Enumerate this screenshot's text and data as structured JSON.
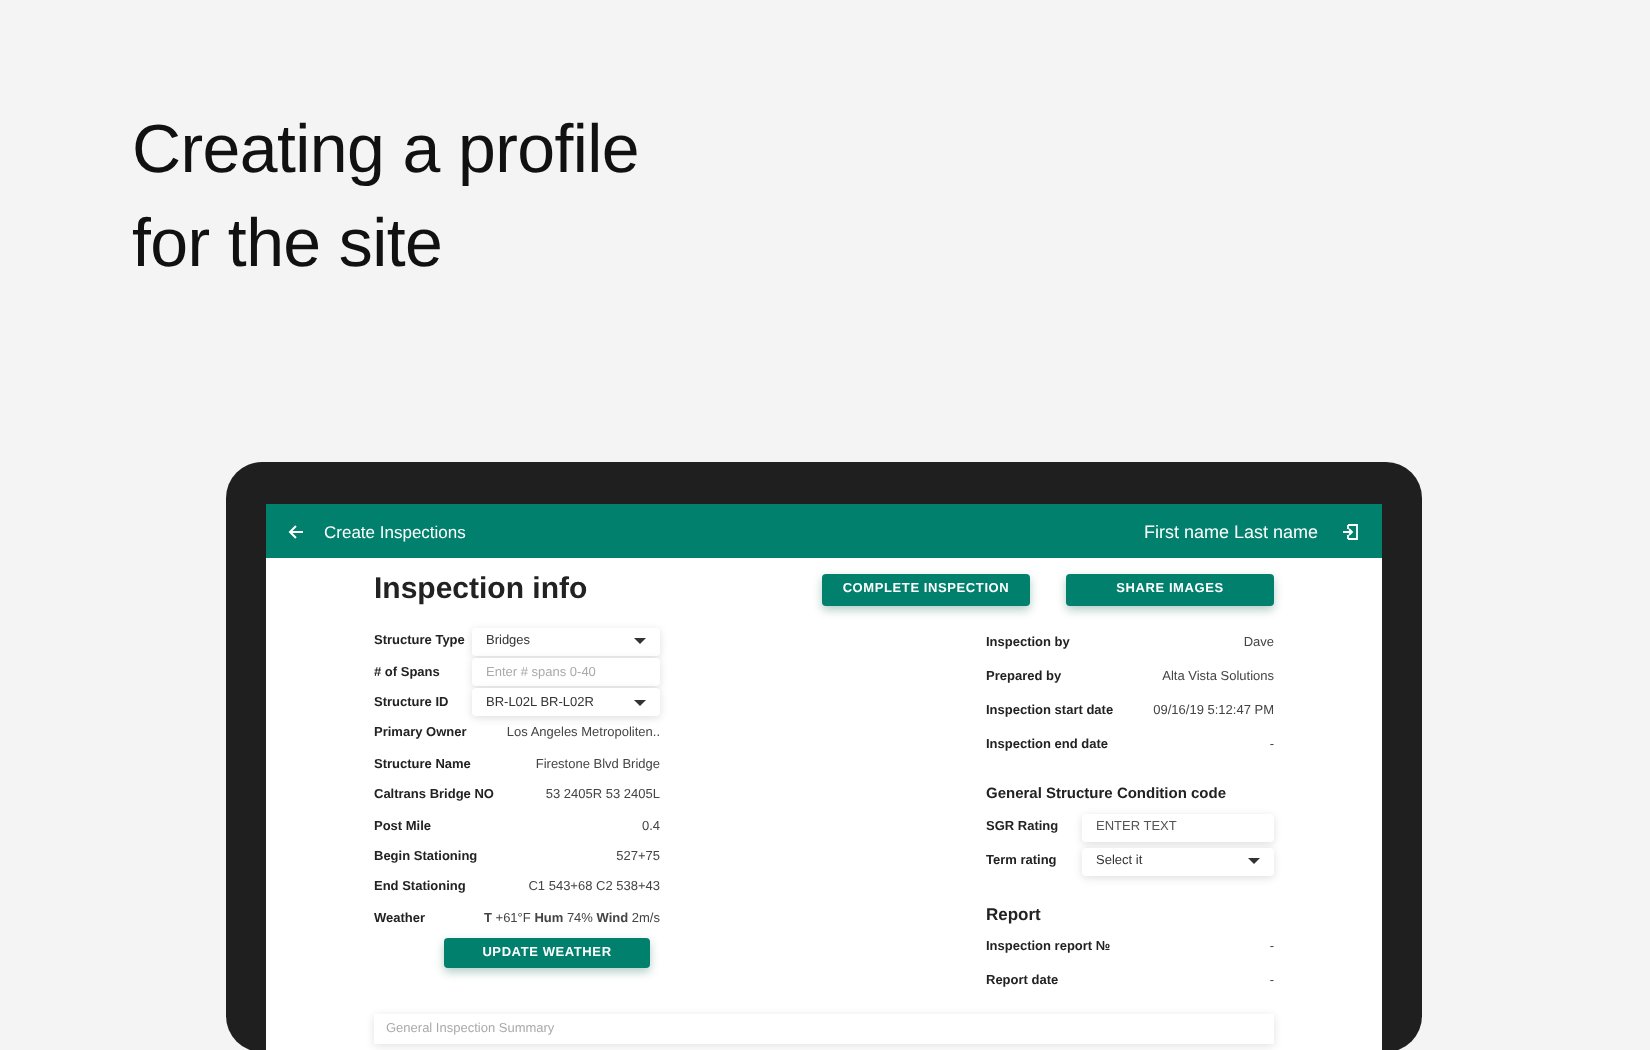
{
  "headline": "Creating a profile\nfor the site",
  "app_bar": {
    "title": "Create Inspections",
    "user": "First name Last name"
  },
  "page_title": "Inspection info",
  "actions": [
    "COMPLETE INSPECTION",
    "SHARE IMAGES"
  ],
  "structure": [
    {
      "kind": "select",
      "label": "Structure Type",
      "value": "Bridges"
    },
    {
      "kind": "input",
      "label": "# of Spans",
      "placeholder": "Enter # spans 0-40"
    },
    {
      "kind": "select",
      "label": "Structure ID",
      "value": "BR-L02L BR-L02R"
    },
    {
      "kind": "text",
      "label": "Primary Owner",
      "value": "Los Angeles Metropoliten.."
    },
    {
      "kind": "text",
      "label": "Structure Name",
      "value": "Firestone Blvd Bridge"
    },
    {
      "kind": "text",
      "label": "Caltrans Bridge NO",
      "value": "53 2405R 53 2405L"
    },
    {
      "kind": "text",
      "label": "Post Mile",
      "value": "0.4"
    },
    {
      "kind": "text",
      "label": "Begin Stationing",
      "value": "527+75"
    },
    {
      "kind": "text",
      "label": "End Stationing",
      "value": "C1 543+68 C2 538+43"
    },
    {
      "kind": "text",
      "label": "Weather",
      "value": "**T** +61°F  **Hum** 74%  **Wind** 2m/s"
    }
  ],
  "update_button": "UPDATE WEATHER",
  "inspection": [
    {
      "kind": "text",
      "label": "Inspection by",
      "value": "Dave"
    },
    {
      "kind": "text",
      "label": "Prepared by",
      "value": "Alta Vista Solutions"
    },
    {
      "kind": "text",
      "label": "Inspection start date",
      "value": "09/16/19  5:12:47 PM"
    },
    {
      "kind": "text",
      "label": "Inspection end date",
      "value": "-"
    }
  ],
  "condition": {
    "heading": "General Structure Condition code",
    "rows": [
      {
        "kind": "input",
        "label": "SGR Rating",
        "placeholder": "ENTER TEXT"
      },
      {
        "kind": "select",
        "label": "Term rating",
        "value": "Select it"
      }
    ]
  },
  "report": {
    "heading": "Report",
    "rows": [
      {
        "kind": "text",
        "label": "Inspection report №",
        "value": "-"
      },
      {
        "kind": "text",
        "label": "Report date",
        "value": "-"
      }
    ]
  },
  "summary": {
    "placeholder": "General Inspection Summary"
  }
}
